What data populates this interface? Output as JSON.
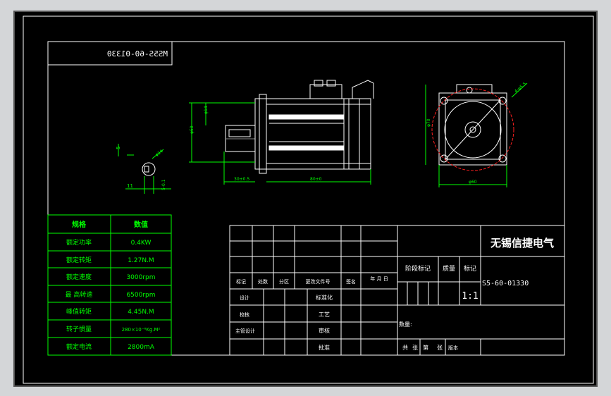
{
  "drawing": {
    "model_code_mirrored": "MS5S-60-01330",
    "company": "无锡信捷电气",
    "drawing_number": "S5-60-01330",
    "scale": "1:1",
    "dims": {
      "flange_side": "φ60",
      "diag": "φ70",
      "pcd": "4-φ5.5",
      "height_a": "φ50",
      "height_b": "φ14",
      "len_a": "30±0.5",
      "len_b": "80±0",
      "key_a": "5",
      "key_b": "11",
      "shaft_d": "φ14",
      "keyway": "5-0.1"
    }
  },
  "spec_table": {
    "header": [
      "规格",
      "数值"
    ],
    "rows": [
      [
        "额定功率",
        "0.4KW"
      ],
      [
        "额定转矩",
        "1.27N.M"
      ],
      [
        "额定速度",
        "3000rpm"
      ],
      [
        "最  高转速",
        "6500rpm"
      ],
      [
        "峰值转矩",
        "4.45N.M"
      ],
      [
        "转子惯量",
        "280×10⁻⁶Kg.M²"
      ],
      [
        "额定电流",
        "2800mA"
      ]
    ]
  },
  "title_block": {
    "rev_headers": [
      "标记",
      "处数",
      "分区",
      "更改文件号",
      "签名",
      "年 月 日"
    ],
    "stage_label": "阶段标记",
    "weight_label": "质量",
    "mark_label": "标记",
    "labels_left": [
      "设计",
      "校核",
      "主管设计"
    ],
    "labels_mid": [
      "标准化",
      "工艺",
      "审核",
      "批准"
    ],
    "quantity_label": "数量:",
    "sheets_a": "共",
    "sheets_b": "张",
    "sheets_c": "第",
    "sheets_d": "张",
    "version_label": "版本"
  },
  "colors": {
    "frame": "#000000",
    "border_white": "#ffffff",
    "dim_green": "#00ff00",
    "motor_white": "#ffffff",
    "circle_red": "#ff2020"
  }
}
